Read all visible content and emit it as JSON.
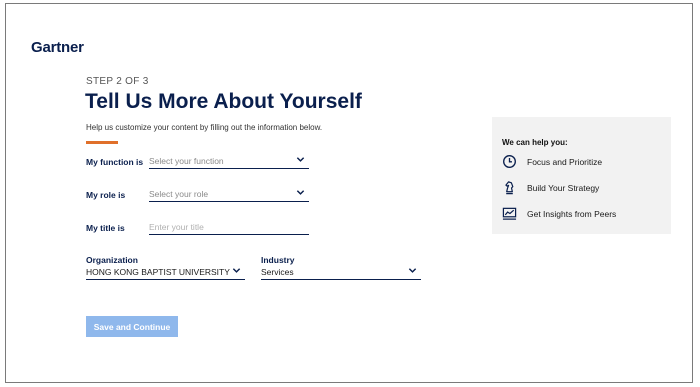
{
  "brand": {
    "logo_text": "Gartner"
  },
  "header": {
    "step": "STEP 2 OF 3",
    "title": "Tell Us More About Yourself",
    "subtitle": "Help us customize your content by filling out the information below."
  },
  "form": {
    "function": {
      "label": "My function is",
      "placeholder": "Select your function"
    },
    "role": {
      "label": "My role is",
      "placeholder": "Select your role"
    },
    "title_field": {
      "label": "My title is",
      "placeholder": "Enter your title"
    },
    "organization": {
      "label": "Organization",
      "value": "HONG KONG BAPTIST UNIVERSITY"
    },
    "industry": {
      "label": "Industry",
      "value": "Services"
    },
    "submit_label": "Save and Continue"
  },
  "help_panel": {
    "title": "We can help you:",
    "items": [
      {
        "icon": "clock-icon",
        "label": "Focus and Prioritize"
      },
      {
        "icon": "chess-knight-icon",
        "label": "Build Your Strategy"
      },
      {
        "icon": "chart-insights-icon",
        "label": "Get Insights from Peers"
      }
    ]
  },
  "colors": {
    "brand_navy": "#0a1f4d",
    "accent_orange": "#e0702a",
    "button_disabled": "#8fb8ec",
    "panel_bg": "#f2f2f2"
  }
}
